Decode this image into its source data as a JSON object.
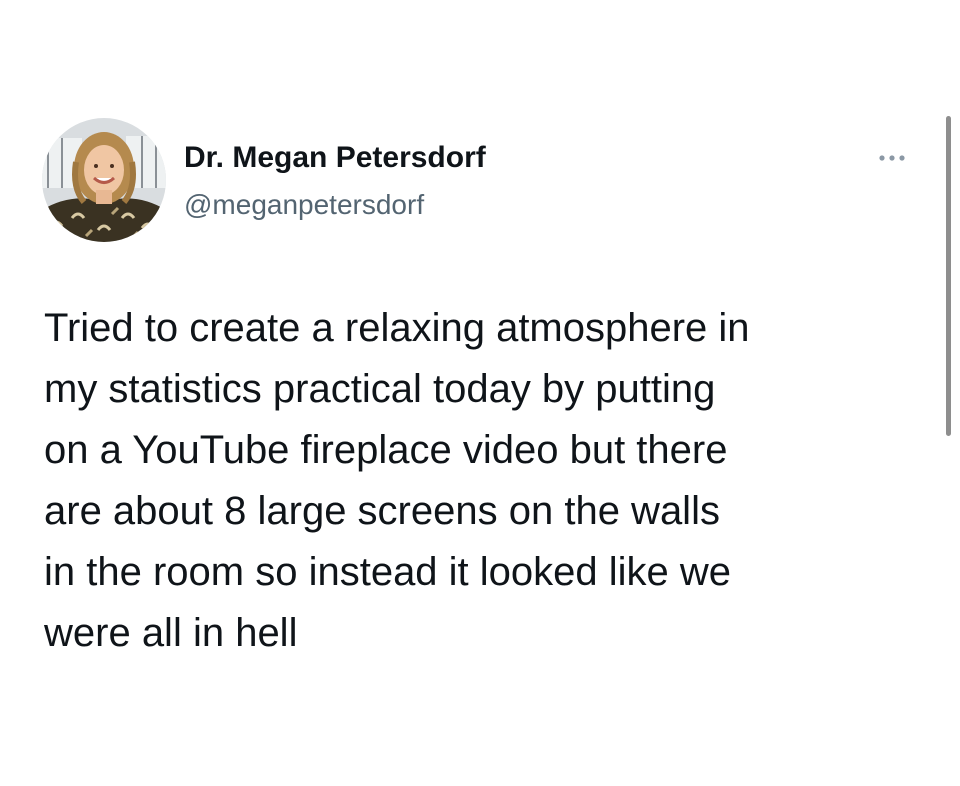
{
  "author": {
    "name": "Dr. Megan Petersdorf",
    "handle": "@meganpetersdorf"
  },
  "tweet": {
    "lines": [
      "Tried to create a relaxing atmosphere in",
      "my statistics practical today by putting",
      "on a YouTube fireplace video but there",
      "are about 8 large screens on the walls",
      "in the room so instead it looked like we",
      "were all in hell"
    ]
  },
  "icons": {
    "more": "more-options-icon",
    "avatar": "profile-photo"
  },
  "colors": {
    "name": "#0f1419",
    "handle": "#536471",
    "body_text": "#0f1419",
    "more_icon": "#8b98a5",
    "scrollbar": "#8e8e8e"
  }
}
